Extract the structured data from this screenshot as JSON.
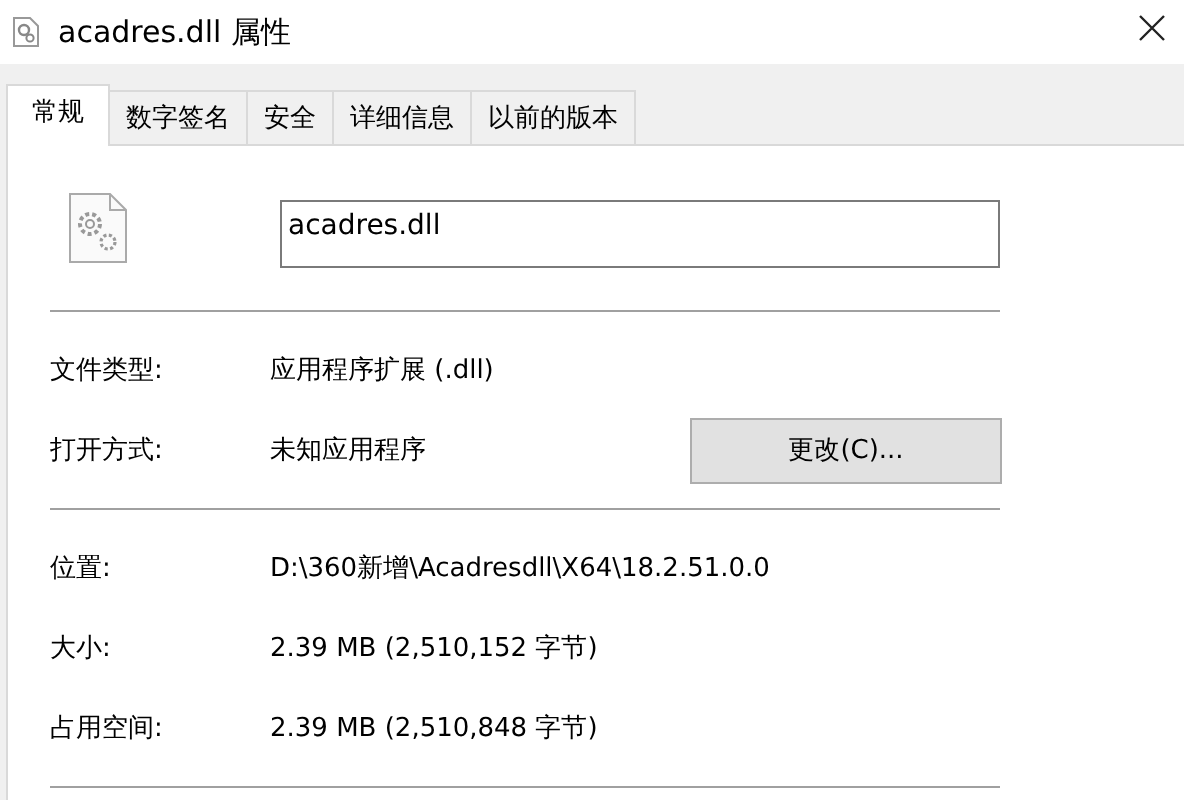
{
  "window": {
    "title": "acadres.dll 属性"
  },
  "tabs": [
    {
      "label": "常规",
      "selected": true
    },
    {
      "label": "数字签名",
      "selected": false
    },
    {
      "label": "安全",
      "selected": false
    },
    {
      "label": "详细信息",
      "selected": false
    },
    {
      "label": "以前的版本",
      "selected": false
    }
  ],
  "file_name": {
    "value": "acadres.dll"
  },
  "sections": [
    {
      "rows": [
        {
          "label": "文件类型:",
          "value": "应用程序扩展 (.dll)"
        },
        {
          "label": "打开方式:",
          "value": "未知应用程序",
          "button": "更改(C)..."
        }
      ]
    },
    {
      "rows": [
        {
          "label": "位置:",
          "value": "D:\\360新增\\Acadresdll\\X64\\18.2.51.0.0"
        },
        {
          "label": "大小:",
          "value": "2.39 MB (2,510,152 字节)"
        },
        {
          "label": "占用空间:",
          "value": "2.39 MB (2,510,848 字节)"
        }
      ]
    }
  ]
}
